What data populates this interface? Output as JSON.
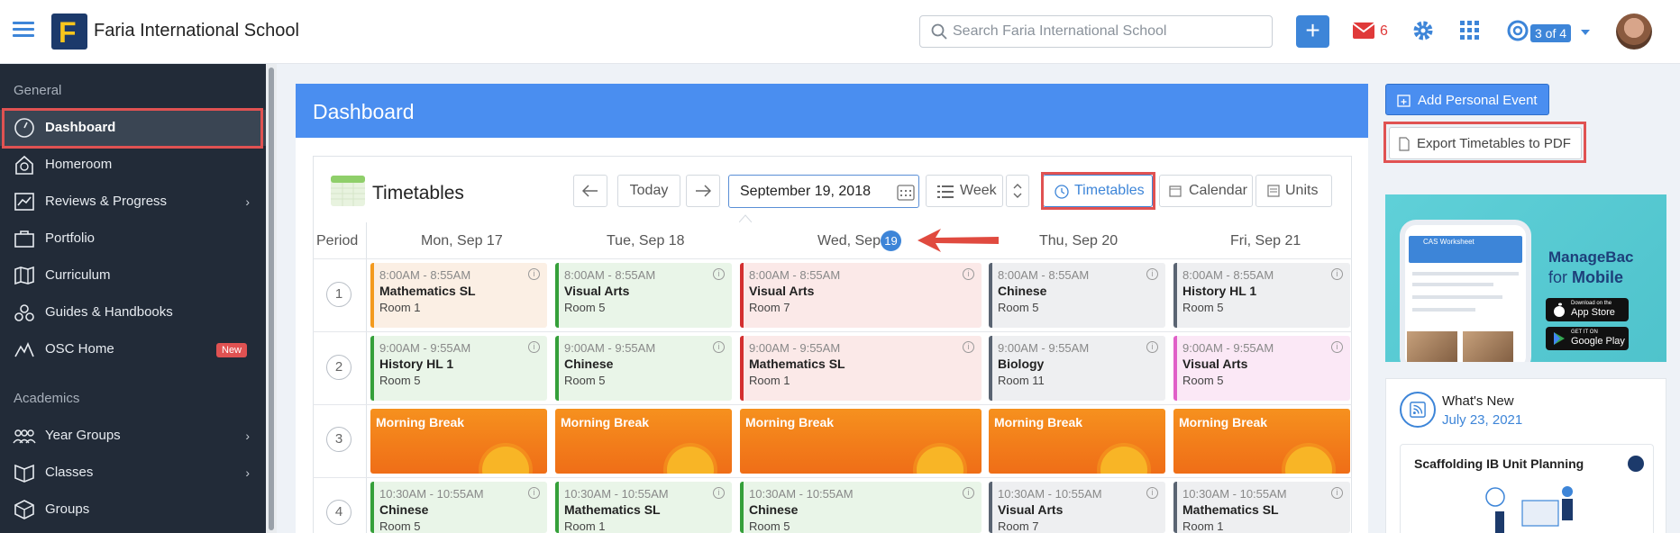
{
  "topbar": {
    "school_name": "Faria International School",
    "search_placeholder": "Search Faria International School",
    "mail_count": "6",
    "help_badge": "3 of 4",
    "add_label": "+"
  },
  "sidebar": {
    "section_general": "General",
    "section_academics": "Academics",
    "items": [
      {
        "label": "Dashboard",
        "icon": "dashboard-icon"
      },
      {
        "label": "Homeroom",
        "icon": "homeroom-icon"
      },
      {
        "label": "Reviews & Progress",
        "icon": "reviews-icon"
      },
      {
        "label": "Portfolio",
        "icon": "portfolio-icon"
      },
      {
        "label": "Curriculum",
        "icon": "curriculum-icon"
      },
      {
        "label": "Guides & Handbooks",
        "icon": "guides-icon"
      },
      {
        "label": "OSC Home",
        "icon": "osc-icon"
      },
      {
        "label": "Year Groups",
        "icon": "year-groups-icon"
      },
      {
        "label": "Classes",
        "icon": "classes-icon"
      },
      {
        "label": "Groups",
        "icon": "groups-icon"
      }
    ],
    "new_badge": "New"
  },
  "dashboard": {
    "title": "Dashboard"
  },
  "timetable": {
    "title": "Timetables",
    "today_label": "Today",
    "date_value": "September 19, 2018",
    "week_label": "Week",
    "view_tabs": [
      "Timetables",
      "Calendar",
      "Units"
    ],
    "period_header": "Period",
    "days": [
      "Mon, Sep 17",
      "Tue, Sep 18",
      "Wed, Sep",
      "Thu, Sep 20",
      "Fri, Sep 21"
    ],
    "today_badge": "19",
    "periods": [
      "1",
      "2",
      "3",
      "4"
    ],
    "break_label": "Morning Break",
    "rows": [
      [
        {
          "time": "8:00AM - 8:55AM",
          "subject": "Mathematics SL",
          "room": "Room 1",
          "color": "orange"
        },
        {
          "time": "8:00AM - 8:55AM",
          "subject": "Visual Arts",
          "room": "Room 5",
          "color": "green"
        },
        {
          "time": "8:00AM - 8:55AM",
          "subject": "Visual Arts",
          "room": "Room 7",
          "color": "red"
        },
        {
          "time": "8:00AM - 8:55AM",
          "subject": "Chinese",
          "room": "Room 5",
          "color": "gray"
        },
        {
          "time": "8:00AM - 8:55AM",
          "subject": "History HL 1",
          "room": "Room 5",
          "color": "gray"
        }
      ],
      [
        {
          "time": "9:00AM - 9:55AM",
          "subject": "History HL 1",
          "room": "Room 5",
          "color": "green"
        },
        {
          "time": "9:00AM - 9:55AM",
          "subject": "Chinese",
          "room": "Room 5",
          "color": "green"
        },
        {
          "time": "9:00AM - 9:55AM",
          "subject": "Mathematics SL",
          "room": "Room 1",
          "color": "red"
        },
        {
          "time": "9:00AM - 9:55AM",
          "subject": "Biology",
          "room": "Room 11",
          "color": "gray"
        },
        {
          "time": "9:00AM - 9:55AM",
          "subject": "Visual Arts",
          "room": "Room 5",
          "color": "pink"
        }
      ],
      [
        {
          "time": "10:30AM - 10:55AM",
          "subject": "Chinese",
          "room": "Room 5",
          "color": "green"
        },
        {
          "time": "10:30AM - 10:55AM",
          "subject": "Mathematics SL",
          "room": "Room 1",
          "color": "green"
        },
        {
          "time": "10:30AM - 10:55AM",
          "subject": "Chinese",
          "room": "Room 5",
          "color": "green"
        },
        {
          "time": "10:30AM - 10:55AM",
          "subject": "Visual Arts",
          "room": "Room 7",
          "color": "gray"
        },
        {
          "time": "10:30AM - 10:55AM",
          "subject": "Mathematics SL",
          "room": "Room 1",
          "color": "gray"
        }
      ]
    ]
  },
  "right": {
    "add_event": "Add Personal Event",
    "export": "Export Timetables to PDF",
    "promo_title": "ManageBac",
    "promo_for": "for",
    "promo_mobile": "Mobile",
    "phone_title": "CAS Worksheet",
    "app_store_top": "Download on the",
    "app_store": "App Store",
    "google_top": "GET IT ON",
    "google": "Google Play",
    "whats_new_title": "What's New",
    "whats_new_date": "July 23, 2021",
    "card_title": "Scaffolding IB Unit Planning"
  },
  "colors": {
    "accent": "#4a8ef0",
    "sidebar_bg": "#222b38",
    "highlight": "#e05252"
  }
}
